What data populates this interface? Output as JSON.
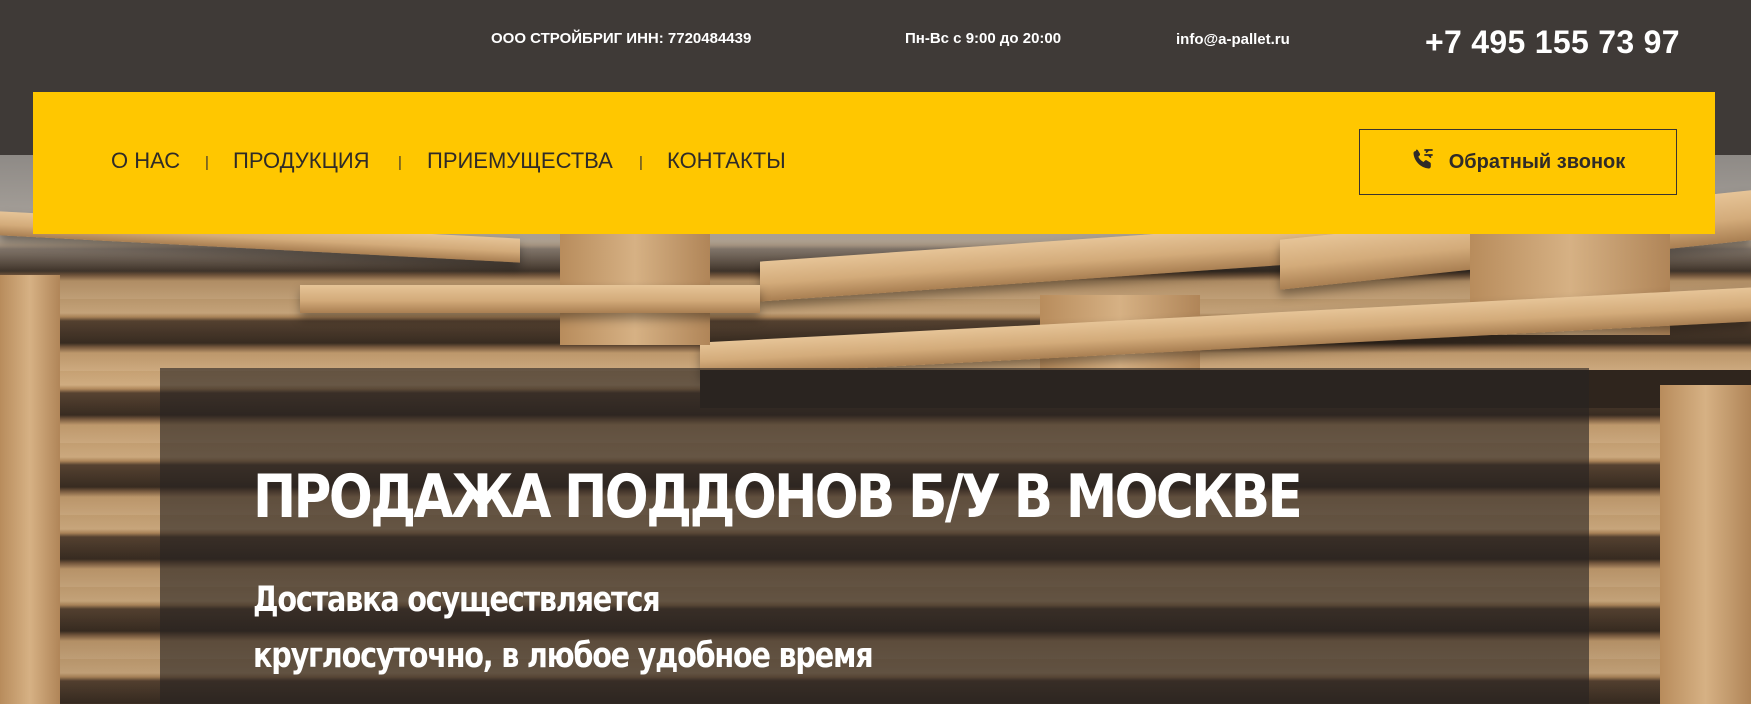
{
  "topbar": {
    "company": "ООО СТРОЙБРИГ ИНН: 7720484439",
    "hours": "Пн-Вс с 9:00 до 20:00",
    "email": "info@a-pallet.ru",
    "phone": "+7 495 155 73 97"
  },
  "nav": {
    "items": [
      {
        "label": "О НАС"
      },
      {
        "label": "ПРОДУКЦИЯ"
      },
      {
        "label": "ПРИЕМУЩЕСТВА"
      },
      {
        "label": "КОНТАКТЫ"
      }
    ],
    "separator": "|",
    "callback_label": "Обратный звонок",
    "callback_icon": "phone-callback-icon"
  },
  "hero": {
    "title": "ПРОДАЖА ПОДДОНОВ Б/У В МОСКВЕ",
    "subtitle_line1": "Доставка осуществляется",
    "subtitle_line2": "круглосуточно, в любое удобное время"
  },
  "colors": {
    "header_bg": "#3f3a37",
    "nav_bg": "#ffc700",
    "text_dark": "#2f2b28",
    "text_light": "#ffffff"
  }
}
